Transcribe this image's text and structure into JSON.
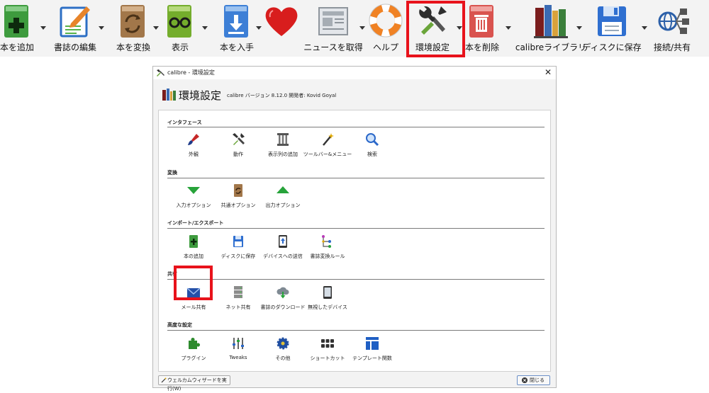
{
  "toolbar": {
    "buttons": [
      {
        "label": "本を追加",
        "icon": "add-book-icon"
      },
      {
        "label": "書誌の編集",
        "icon": "edit-metadata-icon"
      },
      {
        "label": "本を変換",
        "icon": "convert-book-icon"
      },
      {
        "label": "表示",
        "icon": "view-book-icon"
      },
      {
        "label": "本を入手",
        "icon": "get-books-icon"
      },
      {
        "label": "",
        "icon": "heart-icon"
      },
      {
        "label": "ニュースを取得",
        "icon": "news-icon"
      },
      {
        "label": "ヘルプ",
        "icon": "lifebuoy-icon"
      },
      {
        "label": "環境設定",
        "icon": "preferences-icon"
      },
      {
        "label": "本を削除",
        "icon": "trash-icon"
      },
      {
        "label": "calibreライブラリ",
        "icon": "library-icon"
      },
      {
        "label": "ディスクに保存",
        "icon": "floppy-disk-icon"
      },
      {
        "label": "接続/共有",
        "icon": "network-icon"
      }
    ]
  },
  "dialog": {
    "title": "calibre - 環境設定",
    "heading": "環境設定",
    "version_text": "calibre バージョン 8.12.0 開発者: Kovid Goyal",
    "sections": [
      {
        "title": "インタフェース",
        "items": [
          "外観",
          "動作",
          "表示列の追加",
          "ツールバー&メニュー",
          "検索"
        ]
      },
      {
        "title": "変換",
        "items": [
          "入力オプション",
          "共通オプション",
          "出力オプション"
        ]
      },
      {
        "title": "インポート/エクスポート",
        "items": [
          "本の追加",
          "ディスクに保存",
          "デバイスへの送信",
          "書誌変換ルール"
        ]
      },
      {
        "title": "共有",
        "items": [
          "メール共有",
          "ネット共有",
          "書誌のダウンロード",
          "無視したデバイス"
        ]
      },
      {
        "title": "高度な設定",
        "items": [
          "プラグイン",
          "Tweaks",
          "その他",
          "ショートカット",
          "テンプレート関数"
        ]
      }
    ],
    "wizard_button": "ウェルカムウィザードを実行(W)",
    "close_button": "閉じる"
  },
  "colors": {
    "highlight": "#e8121b"
  }
}
